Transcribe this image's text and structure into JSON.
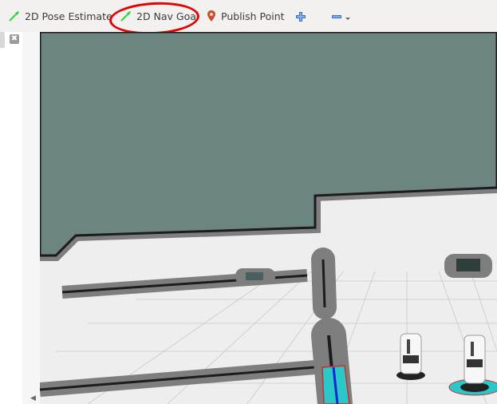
{
  "toolbar": {
    "pose_estimate_label": "2D Pose Estimate",
    "nav_goal_label": "2D Nav Goal",
    "publish_point_label": "Publish Point",
    "add_tool_icon": "plus-icon",
    "remove_tool_icon": "minus-icon",
    "highlighted_tool": "2D Nav Goal"
  },
  "colors": {
    "unknown_space": "#6d8580",
    "free_space": "#f3f3f3",
    "obstacle": "#1c1c1c",
    "inflation": "#7e7e7e",
    "highlight": "#e60000",
    "arrow_green": "#2bd63a",
    "publish_marker": "#c4502f",
    "tool_blue": "#3a6fc4",
    "costmap_cyan": "#2ac8c8",
    "path_blue": "#1525d6"
  },
  "icons": {
    "pose": "green-arrow-icon",
    "nav": "green-arrow-icon",
    "publish": "map-pin-icon",
    "panel_close": "close-icon",
    "scroll": "chevron-left-icon"
  },
  "panel": {
    "close_glyph": "✖"
  }
}
